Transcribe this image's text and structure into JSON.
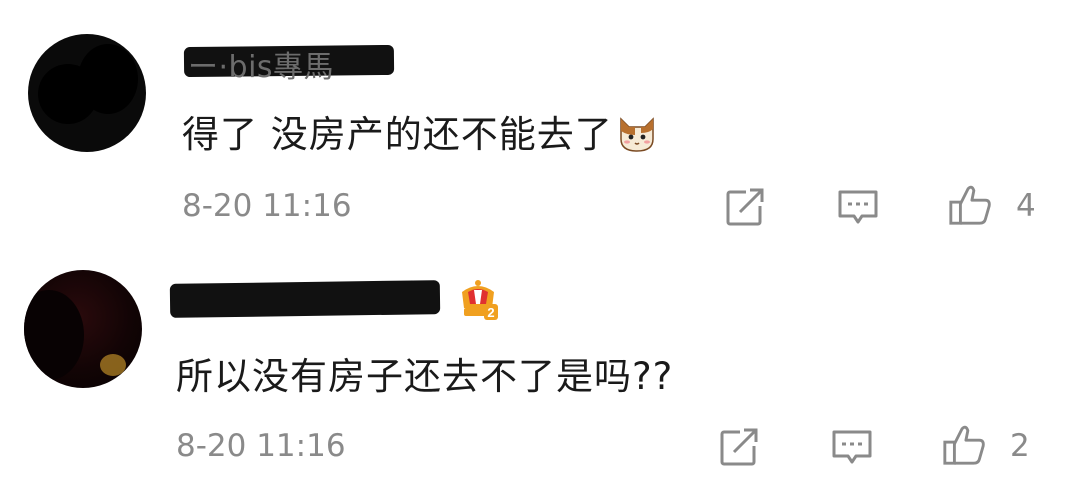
{
  "comments": [
    {
      "username": "ー·bis專馬",
      "text": "得了 没房产的还不能去了",
      "emoji": "cat-face",
      "timestamp": "8-20 11:16",
      "likes": "4"
    },
    {
      "username": "",
      "vip_level": "2",
      "text": "所以没有房子还去不了是吗??",
      "timestamp": "8-20 11:16",
      "likes": "2"
    }
  ],
  "colors": {
    "text_primary": "#1a1a1a",
    "text_secondary": "#8a8a8a",
    "icon": "#8a8a8a",
    "vip_gold": "#f0a020",
    "vip_red": "#e03030"
  },
  "icons": {
    "share": "share-icon",
    "reply": "comment-icon",
    "like": "thumbs-up-icon",
    "vip": "crown-vip-icon"
  }
}
